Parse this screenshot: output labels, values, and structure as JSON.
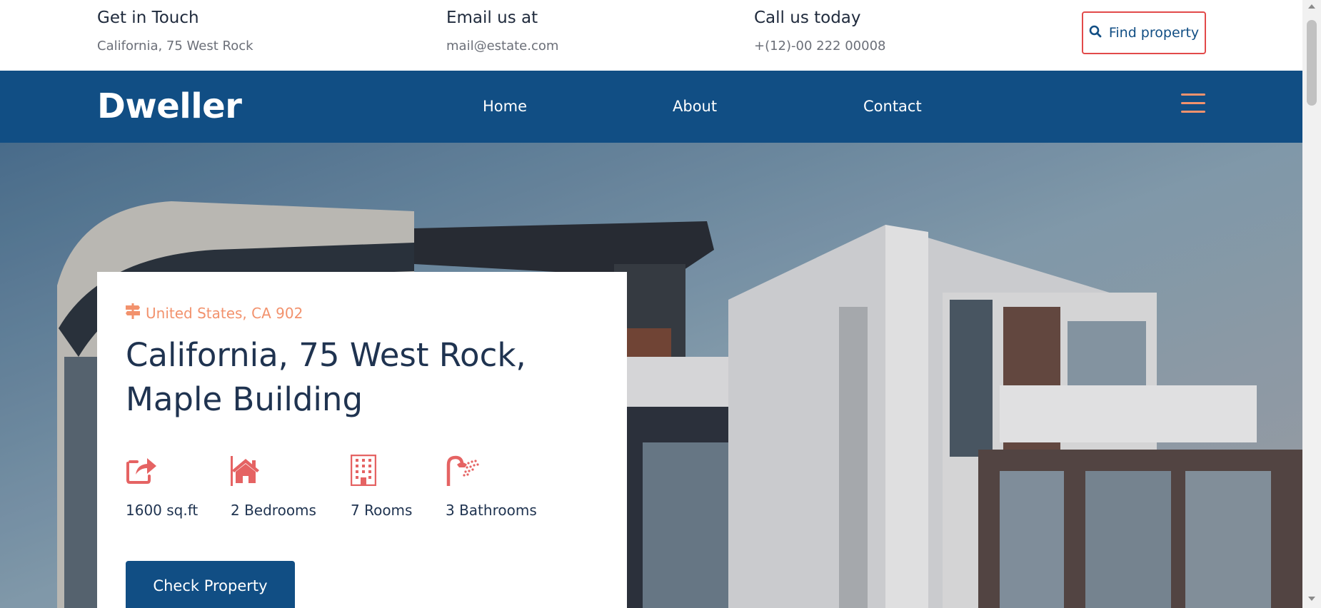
{
  "topbar": {
    "touch": {
      "title": "Get in Touch",
      "value": "California, 75 West Rock"
    },
    "email": {
      "title": "Email us at",
      "value": "mail@estate.com"
    },
    "call": {
      "title": "Call us today",
      "value": "+(12)-00 222 00008"
    },
    "find_button": {
      "label": "Find property",
      "icon": "search-icon"
    }
  },
  "navbar": {
    "logo": "Dweller",
    "links": [
      "Home",
      "About",
      "Contact"
    ],
    "menu_icon": "hamburger-menu-icon"
  },
  "property": {
    "location": "United States, CA 902",
    "location_icon": "signpost-icon",
    "title": "California, 75 West Rock, Maple Building",
    "features": [
      {
        "icon": "share-square-icon",
        "label": "1600 sq.ft"
      },
      {
        "icon": "home-icon",
        "label": "2 Bedrooms"
      },
      {
        "icon": "building-icon",
        "label": "7 Rooms"
      },
      {
        "icon": "shower-icon",
        "label": "3 Bathrooms"
      }
    ],
    "cta": "Check Property"
  },
  "colors": {
    "primary": "#114e84",
    "accent": "#f2926d",
    "icon_red": "#e56363",
    "border_red": "#e24a4a",
    "text_dark": "#1f3350"
  }
}
